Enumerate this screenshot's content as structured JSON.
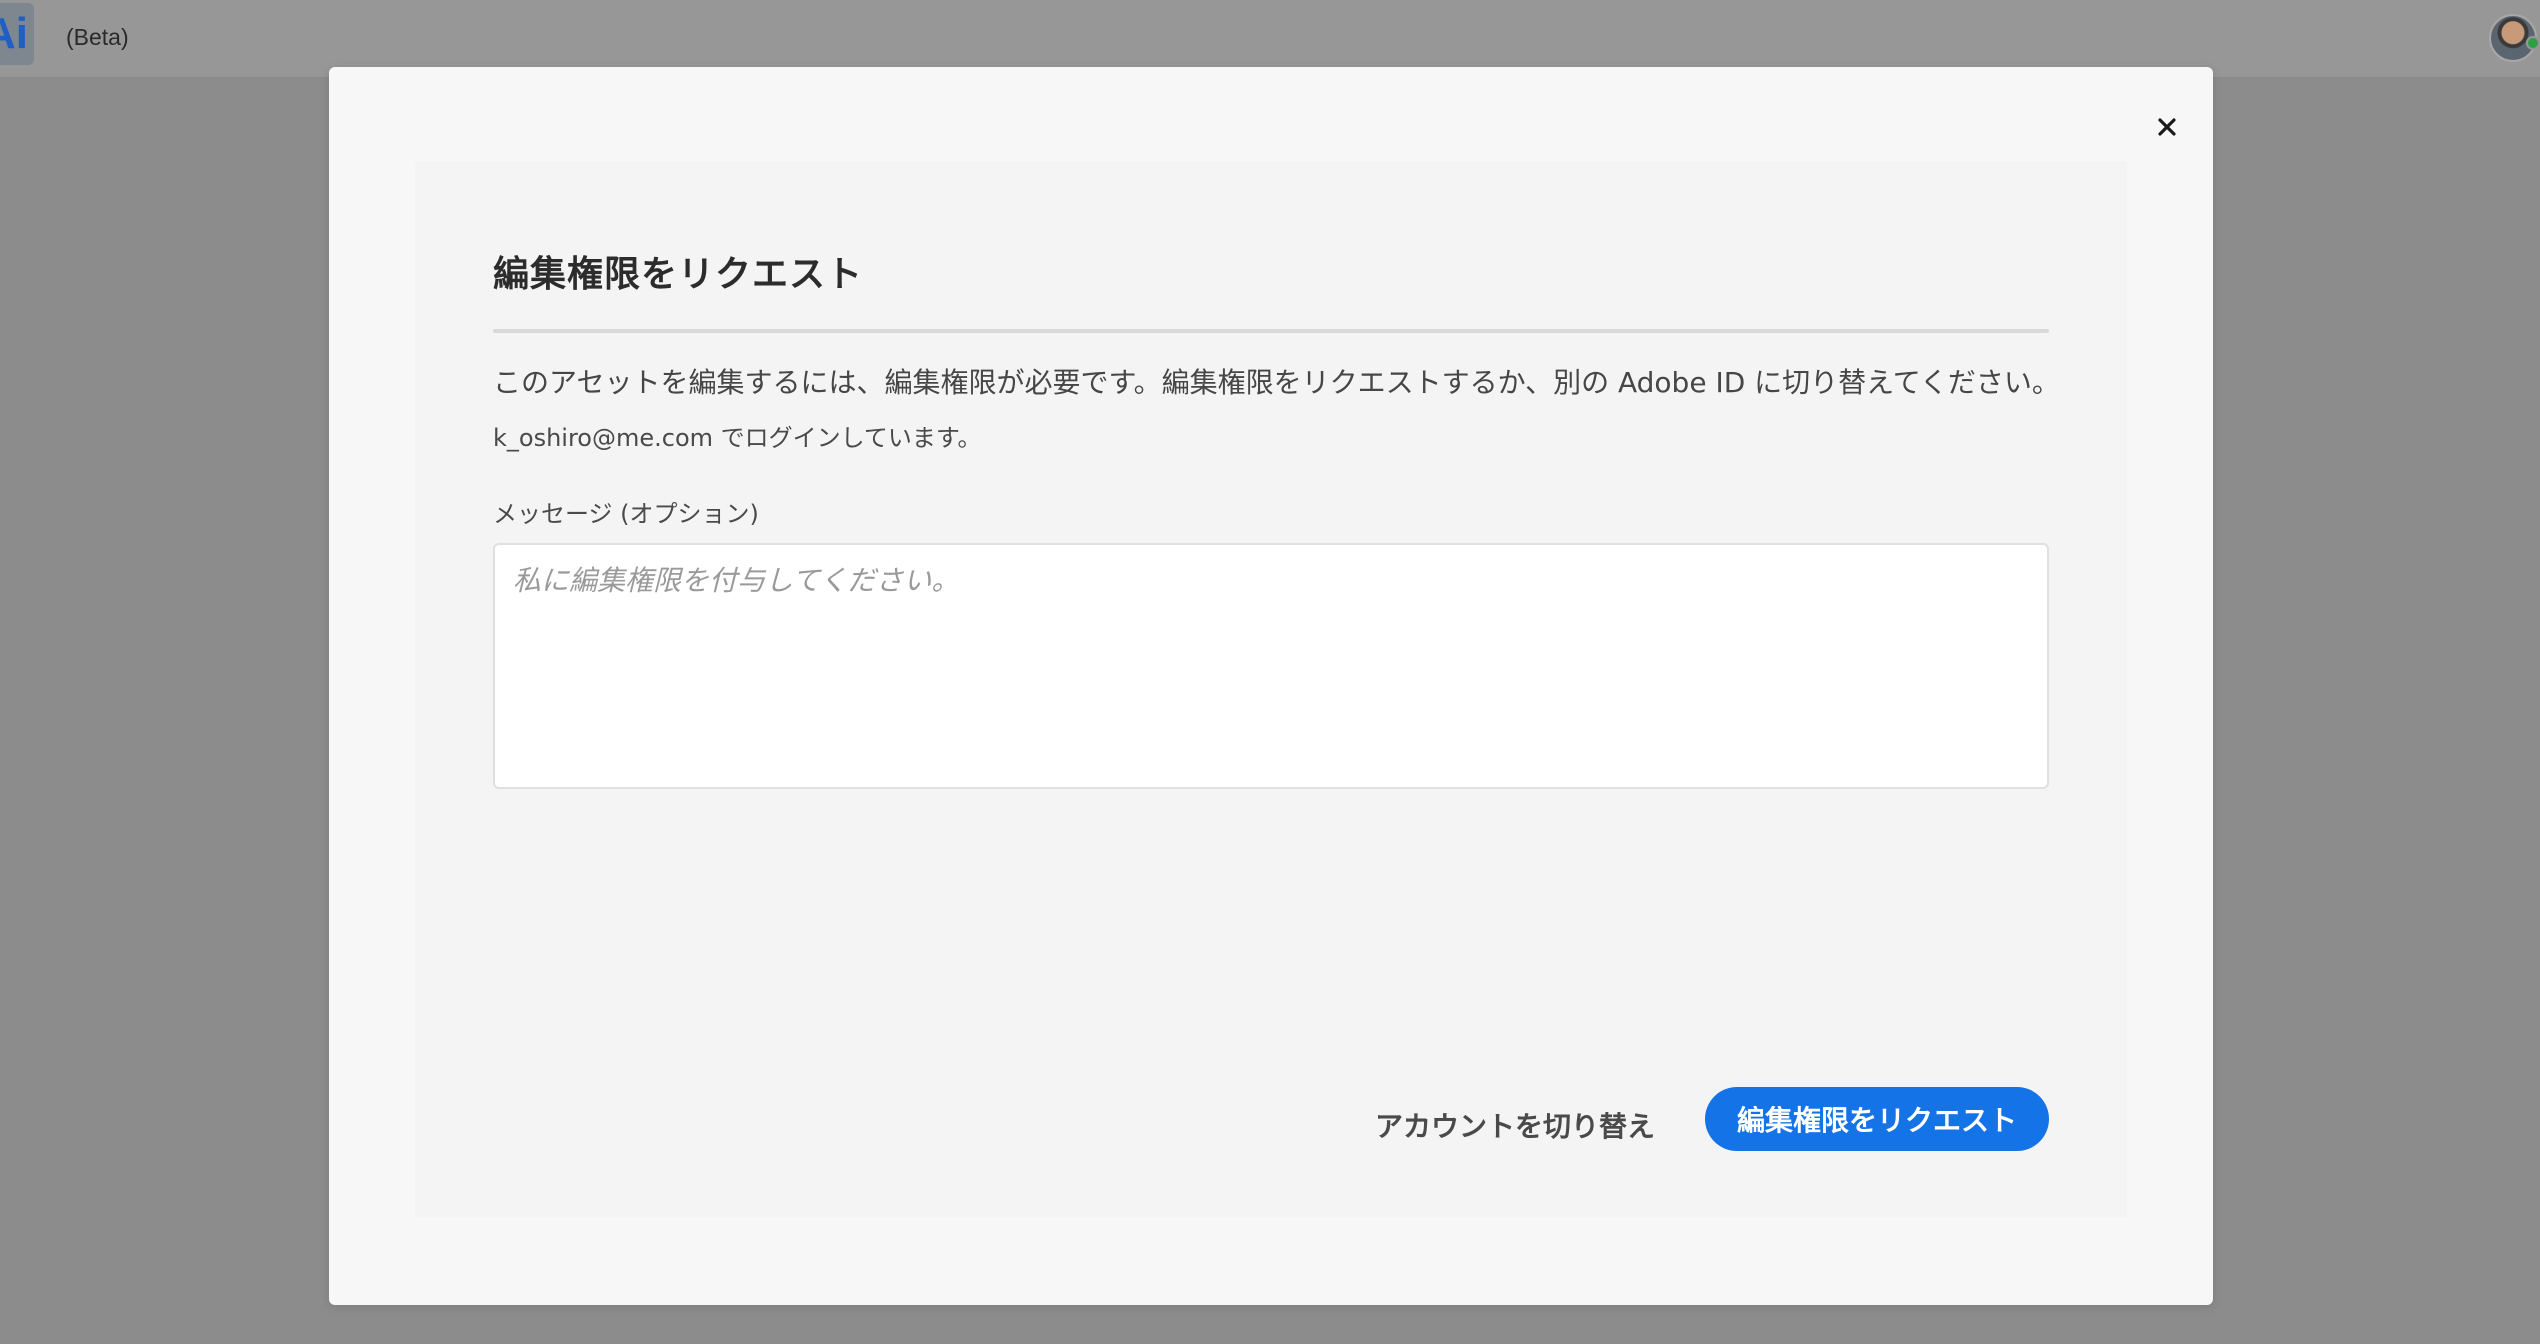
{
  "app": {
    "logo_text": "Ai",
    "beta_label": "(Beta)"
  },
  "dialog": {
    "title": "編集権限をリクエスト",
    "description": "このアセットを編集するには、編集権限が必要です。編集権限をリクエストするか、別の Adobe ID に切り替えてください。",
    "login_status": "k_oshiro@me.com でログインしています。",
    "message_label": "メッセージ (オプション)",
    "message_placeholder": "私に編集権限を付与してください。",
    "message_value": "",
    "switch_account_label": "アカウントを切り替え",
    "request_label": "編集権限をリクエスト",
    "close_icon": "close-icon"
  },
  "colors": {
    "accent": "#1473e6",
    "overlay": "#8c8c8c",
    "dialog_bg": "#f7f7f7"
  }
}
